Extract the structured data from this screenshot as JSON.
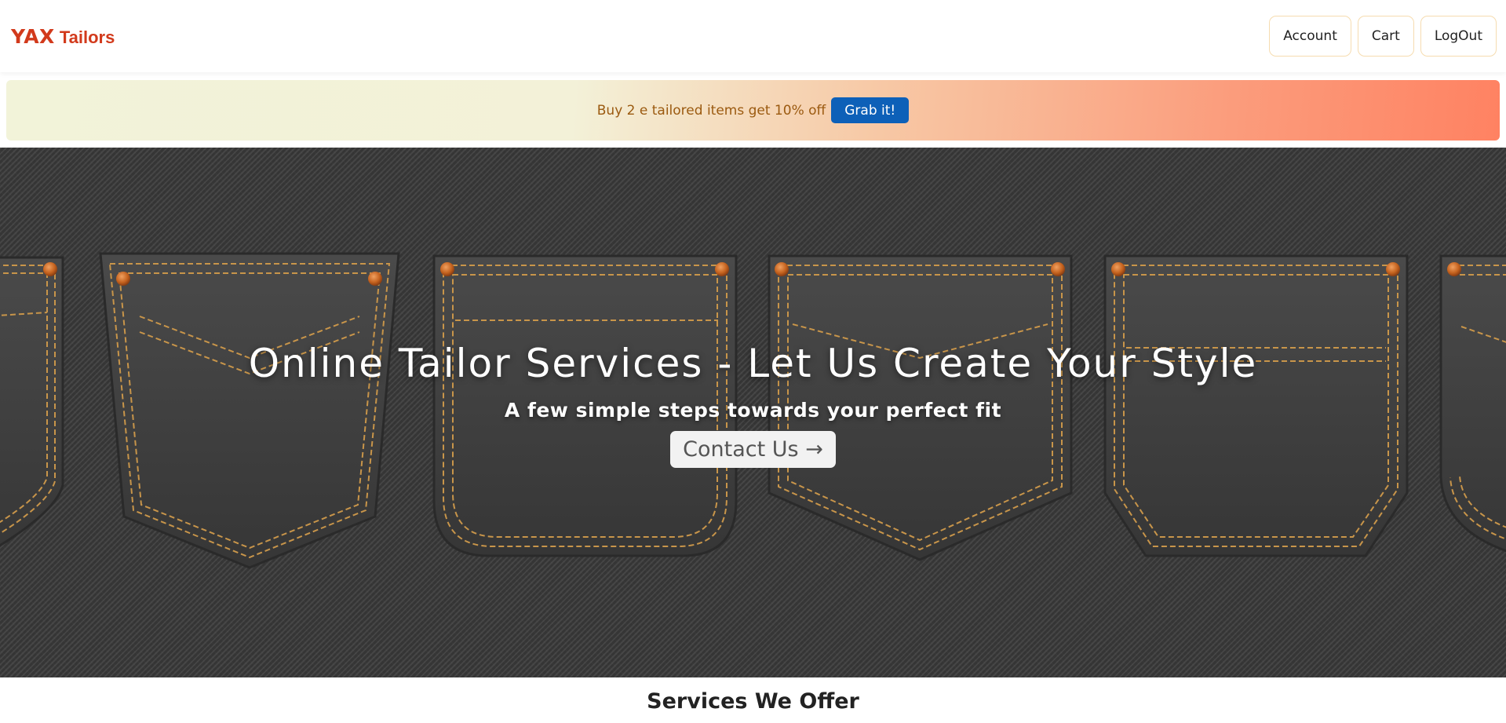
{
  "header": {
    "brand_mark": "YAX",
    "brand_name": "Tailors",
    "nav": {
      "account": "Account",
      "cart": "Cart",
      "logout": "LogOut"
    }
  },
  "promo": {
    "text": "Buy 2 e tailored items get 10% off",
    "button": "Grab it!"
  },
  "hero": {
    "title": "Online Tailor Services - Let Us Create Your Style",
    "subtitle": "A few simple steps towards your perfect fit",
    "cta": "Contact Us →",
    "background": "denim back pockets with orange stitching and copper rivets"
  },
  "services": {
    "heading": "Services We Offer"
  },
  "colors": {
    "brand": "#d23a1c",
    "promo_button": "#0d60b8",
    "promo_text": "#9b5a10",
    "stitch": "#c8954a",
    "rivet": "#d9722a"
  }
}
